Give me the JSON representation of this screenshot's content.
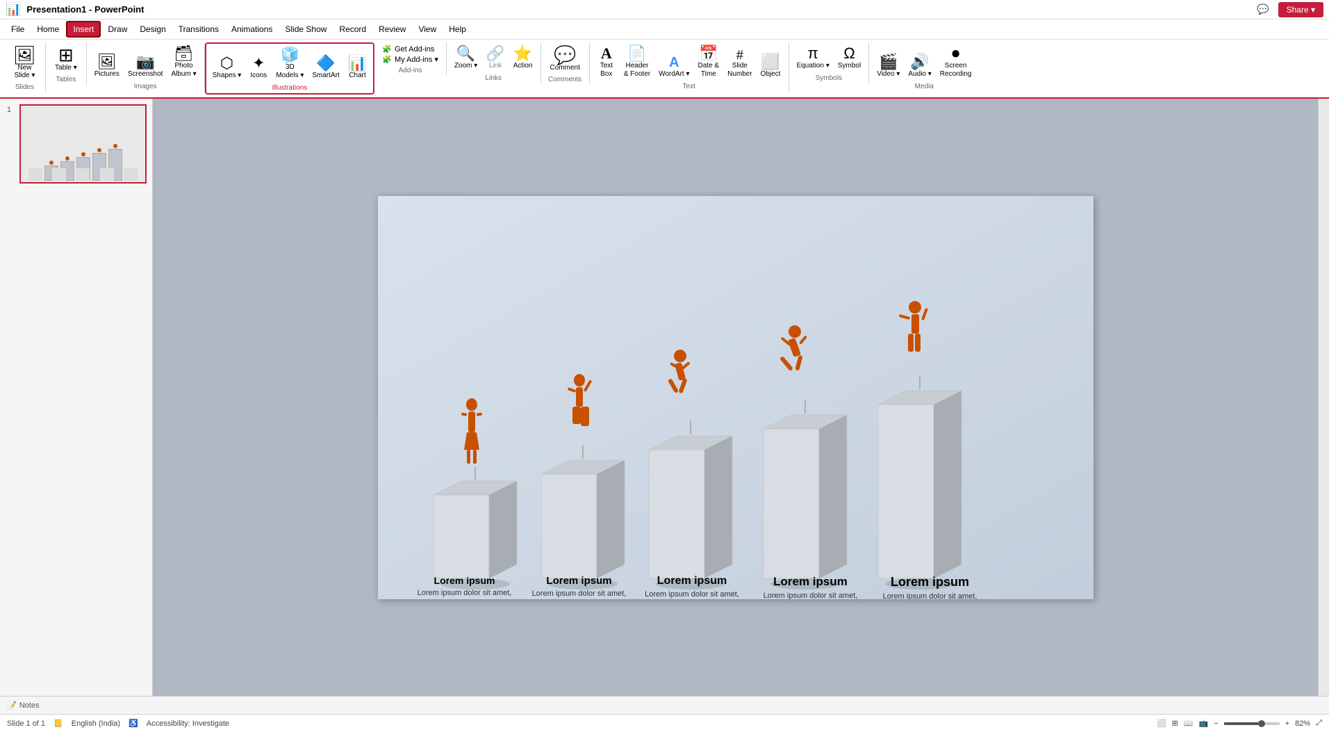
{
  "topbar": {
    "app_icon": "📊",
    "doc_title": "Presentation1 - PowerPoint",
    "comment_btn": "💬",
    "share_label": "Share ▾"
  },
  "menubar": {
    "items": [
      "File",
      "Home",
      "Insert",
      "Draw",
      "Design",
      "Transitions",
      "Animations",
      "Slide Show",
      "Record",
      "Review",
      "View",
      "Help"
    ]
  },
  "ribbon": {
    "active_tab": "Insert",
    "groups": [
      {
        "name": "Slides",
        "label": "Slides",
        "buttons": [
          {
            "icon": "🖼",
            "label": "New\nSlide",
            "has_arrow": true
          }
        ]
      },
      {
        "name": "Tables",
        "label": "Tables",
        "buttons": [
          {
            "icon": "⊞",
            "label": "Table",
            "has_arrow": true
          }
        ]
      },
      {
        "name": "Images",
        "label": "Images",
        "buttons": [
          {
            "icon": "🖼",
            "label": "Pictures",
            "has_arrow": false
          },
          {
            "icon": "📷",
            "label": "Screenshot",
            "has_arrow": false
          },
          {
            "icon": "🗃",
            "label": "Photo\nAlbum",
            "has_arrow": true
          }
        ]
      },
      {
        "name": "Illustrations",
        "label": "Illustrations",
        "highlighted": true,
        "buttons": [
          {
            "icon": "⬠",
            "label": "Shapes",
            "has_arrow": true
          },
          {
            "icon": "✦",
            "label": "Icons",
            "has_arrow": false
          },
          {
            "icon": "🧊",
            "label": "3D\nModels",
            "has_arrow": true
          },
          {
            "icon": "🔷",
            "label": "SmartArt",
            "has_arrow": false
          },
          {
            "icon": "📊",
            "label": "Chart",
            "has_arrow": false
          }
        ]
      },
      {
        "name": "Add-ins",
        "label": "Add-ins",
        "stacked": [
          {
            "icon": "🧩",
            "label": "Get Add-ins"
          },
          {
            "icon": "🧩",
            "label": "My Add-ins ▾"
          }
        ]
      },
      {
        "name": "Links",
        "label": "Links",
        "buttons": [
          {
            "icon": "🔍",
            "label": "Zoom",
            "has_arrow": true
          },
          {
            "icon": "🔗",
            "label": "Link",
            "has_arrow": false,
            "disabled": true
          },
          {
            "icon": "⭐",
            "label": "Action",
            "has_arrow": false
          }
        ]
      },
      {
        "name": "Comments",
        "label": "Comments",
        "buttons": [
          {
            "icon": "💬",
            "label": "Comment",
            "has_arrow": false
          }
        ]
      },
      {
        "name": "Text",
        "label": "Text",
        "buttons": [
          {
            "icon": "A",
            "label": "Text\nBox",
            "has_arrow": false
          },
          {
            "icon": "📄",
            "label": "Header\n& Footer",
            "has_arrow": false
          },
          {
            "icon": "A✦",
            "label": "WordArt",
            "has_arrow": true
          },
          {
            "icon": "📅",
            "label": "Date &\nTime",
            "has_arrow": false
          },
          {
            "icon": "#",
            "label": "Slide\nNumber",
            "has_arrow": false
          },
          {
            "icon": "Ω",
            "label": "Object",
            "has_arrow": false
          }
        ]
      },
      {
        "name": "Symbols",
        "label": "Symbols",
        "buttons": [
          {
            "icon": "π",
            "label": "Equation",
            "has_arrow": true
          },
          {
            "icon": "Ω",
            "label": "Symbol",
            "has_arrow": false
          }
        ]
      },
      {
        "name": "Media",
        "label": "Media",
        "buttons": [
          {
            "icon": "🎬",
            "label": "Video",
            "has_arrow": true
          },
          {
            "icon": "🔊",
            "label": "Audio",
            "has_arrow": true
          },
          {
            "icon": "⏺",
            "label": "Screen\nRecording",
            "has_arrow": false
          }
        ]
      }
    ]
  },
  "slide": {
    "number": "1",
    "columns": [
      {
        "title": "Lorem ipsum",
        "body": "Lorem ipsum dolor sit amet, consectetuer adipiscing elit.",
        "pillar_height": 120,
        "font_size": "14px",
        "font_weight": "bold"
      },
      {
        "title": "Lorem ipsum",
        "body": "Lorem ipsum dolor sit amet, consectetuer adipiscing elit.",
        "pillar_height": 145,
        "font_size": "15px",
        "font_weight": "bold"
      },
      {
        "title": "Lorem ipsum",
        "body": "Lorem ipsum dolor sit amet, consectetuer adipiscing elit.",
        "pillar_height": 175,
        "font_size": "16px",
        "font_weight": "bold"
      },
      {
        "title": "Lorem ipsum",
        "body": "Lorem ipsum dolor sit amet, consectetuer adipiscing elit.",
        "pillar_height": 200,
        "font_size": "17px",
        "font_weight": "bold"
      },
      {
        "title": "Lorem ipsum",
        "body": "Lorem ipsum dolor sit amet, consectetuer adipiscing elit.",
        "pillar_height": 225,
        "font_size": "18px",
        "font_weight": "bold"
      }
    ]
  },
  "statusbar": {
    "slide_info": "Slide 1 of 1",
    "language": "English (India)",
    "accessibility": "Accessibility: Investigate",
    "notes_label": "Notes",
    "zoom_percent": "82%"
  }
}
